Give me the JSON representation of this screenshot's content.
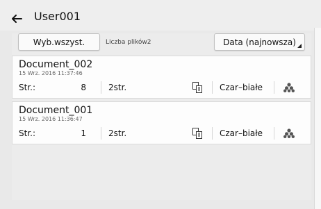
{
  "header": {
    "title": "User001"
  },
  "toolbar": {
    "select_all_label": "Wyb.wszyst.",
    "file_count_label": "Liczba plików2",
    "sort_label": "Data (najnowsza)"
  },
  "documents": [
    {
      "name": "Document_002",
      "timestamp": "15 Wrz. 2016 11:37:46",
      "pages_label": "Str.:",
      "pages_value": "8",
      "duplex_label": "2str.",
      "color_label": "Czar–białe"
    },
    {
      "name": "Document_001",
      "timestamp": "15 Wrz. 2016 11:36:47",
      "pages_label": "Str.:",
      "pages_value": "1",
      "duplex_label": "2str.",
      "color_label": "Czar–białe"
    }
  ],
  "icons": {
    "back": "back-arrow-icon",
    "layout": "layout-icon",
    "color": "toner-icon"
  }
}
